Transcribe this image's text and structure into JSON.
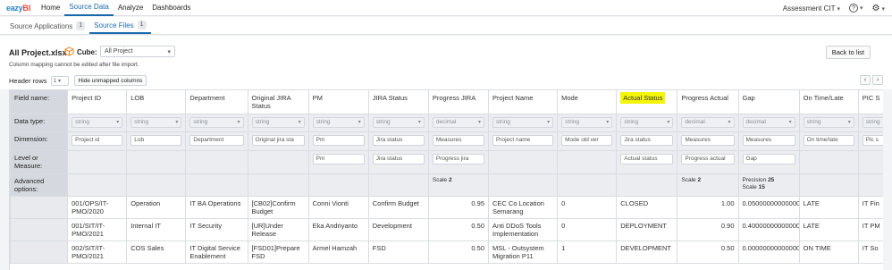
{
  "app": {
    "logo_part1": "eazy",
    "logo_part2": "BI",
    "nav": [
      "Home",
      "Source Data",
      "Analyze",
      "Dashboards"
    ],
    "account": "Assessment CIT",
    "help_icon": "help-icon",
    "settings_icon": "gear-icon"
  },
  "subtabs": [
    {
      "label": "Source Applications",
      "count": "1"
    },
    {
      "label": "Source Files",
      "count": "1"
    }
  ],
  "header": {
    "file_title": "All Project.xlsx",
    "cube_label": "Cube:",
    "cube_value": "All Project",
    "note": "Column mapping cannot be edited after file import.",
    "back_label": "Back to list",
    "header_rows_label": "Header rows",
    "header_rows_value": "1",
    "hide_unmapped_label": "Hide unmapped columns",
    "pager_prev": "‹",
    "pager_next": "›"
  },
  "row_labels": {
    "field_name": "Field name:",
    "data_type": "Data type:",
    "dimension": "Dimension:",
    "level_line1": "Level or",
    "level_line2": "Measure:",
    "advanced_line1": "Advanced",
    "advanced_line2": "options:"
  },
  "columns": [
    {
      "field": "Project ID",
      "type": "string",
      "dimension": "Project id",
      "level": "",
      "adv": []
    },
    {
      "field": "LOB",
      "type": "string",
      "dimension": "Lob",
      "level": "",
      "adv": []
    },
    {
      "field": "Department",
      "type": "string",
      "dimension": "Department",
      "level": "",
      "adv": []
    },
    {
      "field": "Original JIRA Status",
      "type": "string",
      "dimension": "Original jira sta",
      "level": "",
      "adv": []
    },
    {
      "field": "PM",
      "type": "string",
      "dimension": "Pm",
      "level": "Pm",
      "adv": []
    },
    {
      "field": "JIRA Status",
      "type": "string",
      "dimension": "Jira status",
      "level": "Jira status",
      "adv": []
    },
    {
      "field": "Progress JIRA",
      "type": "decimal",
      "dimension": "Measures",
      "level": "Progress jira",
      "adv": [
        {
          "k": "Scale",
          "v": "2"
        }
      ]
    },
    {
      "field": "Project Name",
      "type": "string",
      "dimension": "Project name",
      "level": "",
      "adv": []
    },
    {
      "field": "Mode",
      "type": "string",
      "dimension": "Mode old ver",
      "level": "",
      "adv": []
    },
    {
      "field": "Actual Status",
      "type": "string",
      "dimension": "Jira status",
      "level": "Actual status",
      "adv": [],
      "highlight": true
    },
    {
      "field": "Progress Actual",
      "type": "decimal",
      "dimension": "Measures",
      "level": "Progress actual",
      "adv": [
        {
          "k": "Scale",
          "v": "2"
        }
      ]
    },
    {
      "field": "Gap",
      "type": "decimal",
      "dimension": "Measures",
      "level": "Gap",
      "adv": [
        {
          "k": "Precision",
          "v": "25"
        },
        {
          "k": "Scale",
          "v": "15"
        }
      ]
    },
    {
      "field": "On Time/Late",
      "type": "string",
      "dimension": "On time/late",
      "level": "",
      "adv": []
    },
    {
      "field": "PIC S",
      "type": "string",
      "dimension": "Pic s",
      "level": "",
      "adv": []
    }
  ],
  "rows": [
    [
      "001/OPS/IT-PMO/2020",
      "Operation",
      "IT BA Operations",
      "[CB02]Confirm Budget",
      "Conni Vionti",
      "Confirm Budget",
      "0.95",
      "CEC Co Location Semarang",
      "0",
      "CLOSED",
      "1.00",
      "0.050000000000000",
      "LATE",
      "IT Fin"
    ],
    [
      "001/SIT/IT-PMO/2021",
      "Internal IT",
      "IT Security",
      "[UR]Under Release",
      "Eka Andriyanto",
      "Development",
      "0.50",
      "Anti DDoS Tools Implementation",
      "0",
      "DEPLOYMENT",
      "0.90",
      "0.400000000000000",
      "LATE",
      "IT PM"
    ],
    [
      "002/SIT/IT-PMO/2021",
      "COS Sales",
      "IT Digital Service Enablement",
      "[FSD01]Prepare FSD",
      "Armel Hamzah",
      "FSD",
      "0.50",
      "MSL - Outsystem Migration P11",
      "1",
      "DEVELOPMENT",
      "0.50",
      "0.000000000000000",
      "ON TIME",
      "IT So"
    ]
  ],
  "numeric_cols": [
    6,
    10
  ]
}
